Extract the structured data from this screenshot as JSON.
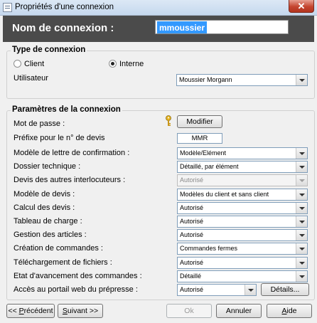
{
  "window": {
    "title": "Propriétés d'une connexion",
    "close_glyph": "✕"
  },
  "header": {
    "label": "Nom de connexion :",
    "name_value": "mmoussier"
  },
  "type_group": {
    "title": "Type de connexion",
    "client_label": "Client",
    "interne_label": "Interne",
    "selected": "Interne",
    "user_label": "Utilisateur",
    "user_value": "Moussier Morgann"
  },
  "params_group": {
    "title": "Paramètres de la connexion",
    "password_label": "Mot de passe :",
    "modify_button": "Modifier",
    "prefix_label": "Préfixe pour le n° de devis",
    "prefix_value": "MMR",
    "rows": [
      {
        "label": "Modèle de lettre de confirmation :",
        "value": "Modèle/Elément",
        "disabled": false
      },
      {
        "label": "Dossier technique :",
        "value": "Détaillé, par élément",
        "disabled": false
      },
      {
        "label": "Devis des autres interlocuteurs :",
        "value": "Autorisé",
        "disabled": true
      },
      {
        "label": "Modèle de devis :",
        "value": "Modèles du client et sans client",
        "disabled": false
      },
      {
        "label": "Calcul des devis :",
        "value": "Autorisé",
        "disabled": false
      },
      {
        "label": "Tableau de charge :",
        "value": "Autorisé",
        "disabled": false
      },
      {
        "label": "Gestion des articles :",
        "value": "Autorisé",
        "disabled": false
      },
      {
        "label": "Création de commandes :",
        "value": "Commandes fermes",
        "disabled": false
      },
      {
        "label": "Téléchargement de fichiers :",
        "value": "Autorisé",
        "disabled": false
      },
      {
        "label": "Etat d'avancement des commandes :",
        "value": "Détaillé",
        "disabled": false
      },
      {
        "label": "Accès au portail web du prépresse :",
        "value": "Autorisé",
        "disabled": false
      }
    ],
    "details_button": "Détails..."
  },
  "footer": {
    "prev_button": {
      "prefix": "<< ",
      "underlined": "P",
      "rest": "récédent"
    },
    "next_button": {
      "underlined": "S",
      "rest": "uivant >>"
    },
    "ok_button": "Ok",
    "cancel_button": "Annuler",
    "help_button": {
      "underlined": "A",
      "rest": "ide"
    }
  }
}
